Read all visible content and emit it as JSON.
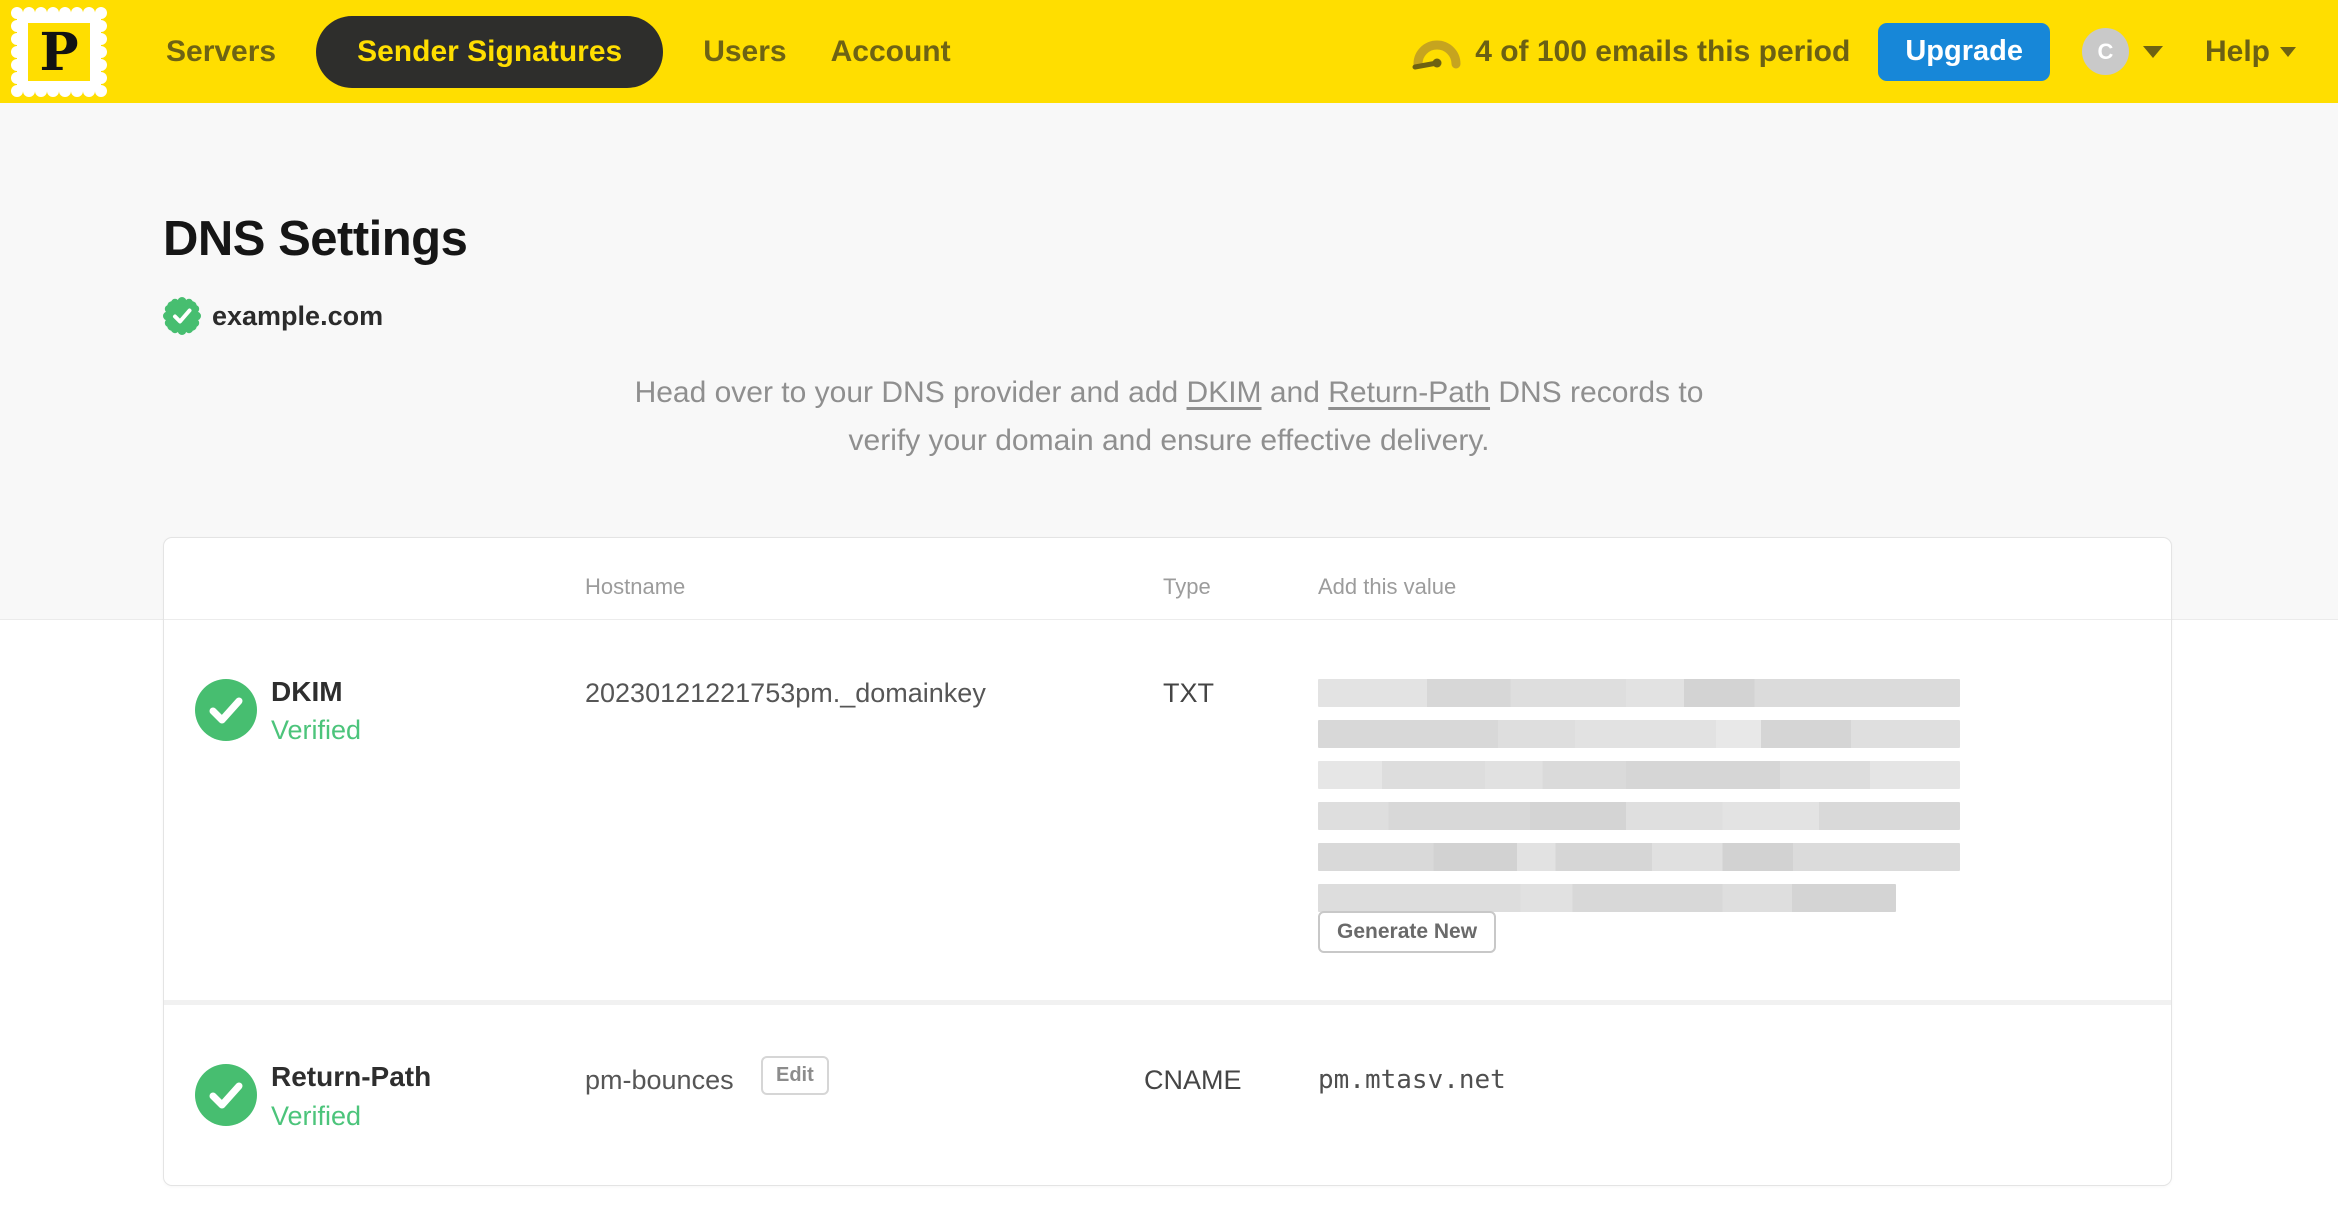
{
  "colors": {
    "brand_yellow": "#FFDE00",
    "nav_active_bg": "#2E2E2C",
    "upgrade_blue": "#1787D8",
    "verified_green": "#47BE70"
  },
  "nav": {
    "logo_letter": "P",
    "items": [
      {
        "label": "Servers",
        "active": false
      },
      {
        "label": "Sender Signatures",
        "active": true
      },
      {
        "label": "Users",
        "active": false
      },
      {
        "label": "Account",
        "active": false
      }
    ],
    "usage_text": "4 of 100 emails this period",
    "upgrade_label": "Upgrade",
    "avatar_initial": "C",
    "help_label": "Help"
  },
  "page": {
    "title": "DNS Settings",
    "domain": "example.com",
    "instructions": {
      "part1": "Head over to your DNS provider and add ",
      "link_dkim": "DKIM",
      "part2": " and ",
      "link_return_path": "Return-Path",
      "part3": " DNS records to",
      "line2": "verify your domain and ensure effective delivery."
    }
  },
  "table": {
    "columns": {
      "hostname": "Hostname",
      "type": "Type",
      "value": "Add this value"
    },
    "rows": [
      {
        "name": "DKIM",
        "status": "Verified",
        "hostname": "20230121221753pm._domainkey",
        "type": "TXT",
        "value_redacted": true,
        "action_label": "Generate New"
      },
      {
        "name": "Return-Path",
        "status": "Verified",
        "hostname": "pm-bounces",
        "edit_label": "Edit",
        "type": "CNAME",
        "value": "pm.mtasv.net"
      }
    ]
  }
}
